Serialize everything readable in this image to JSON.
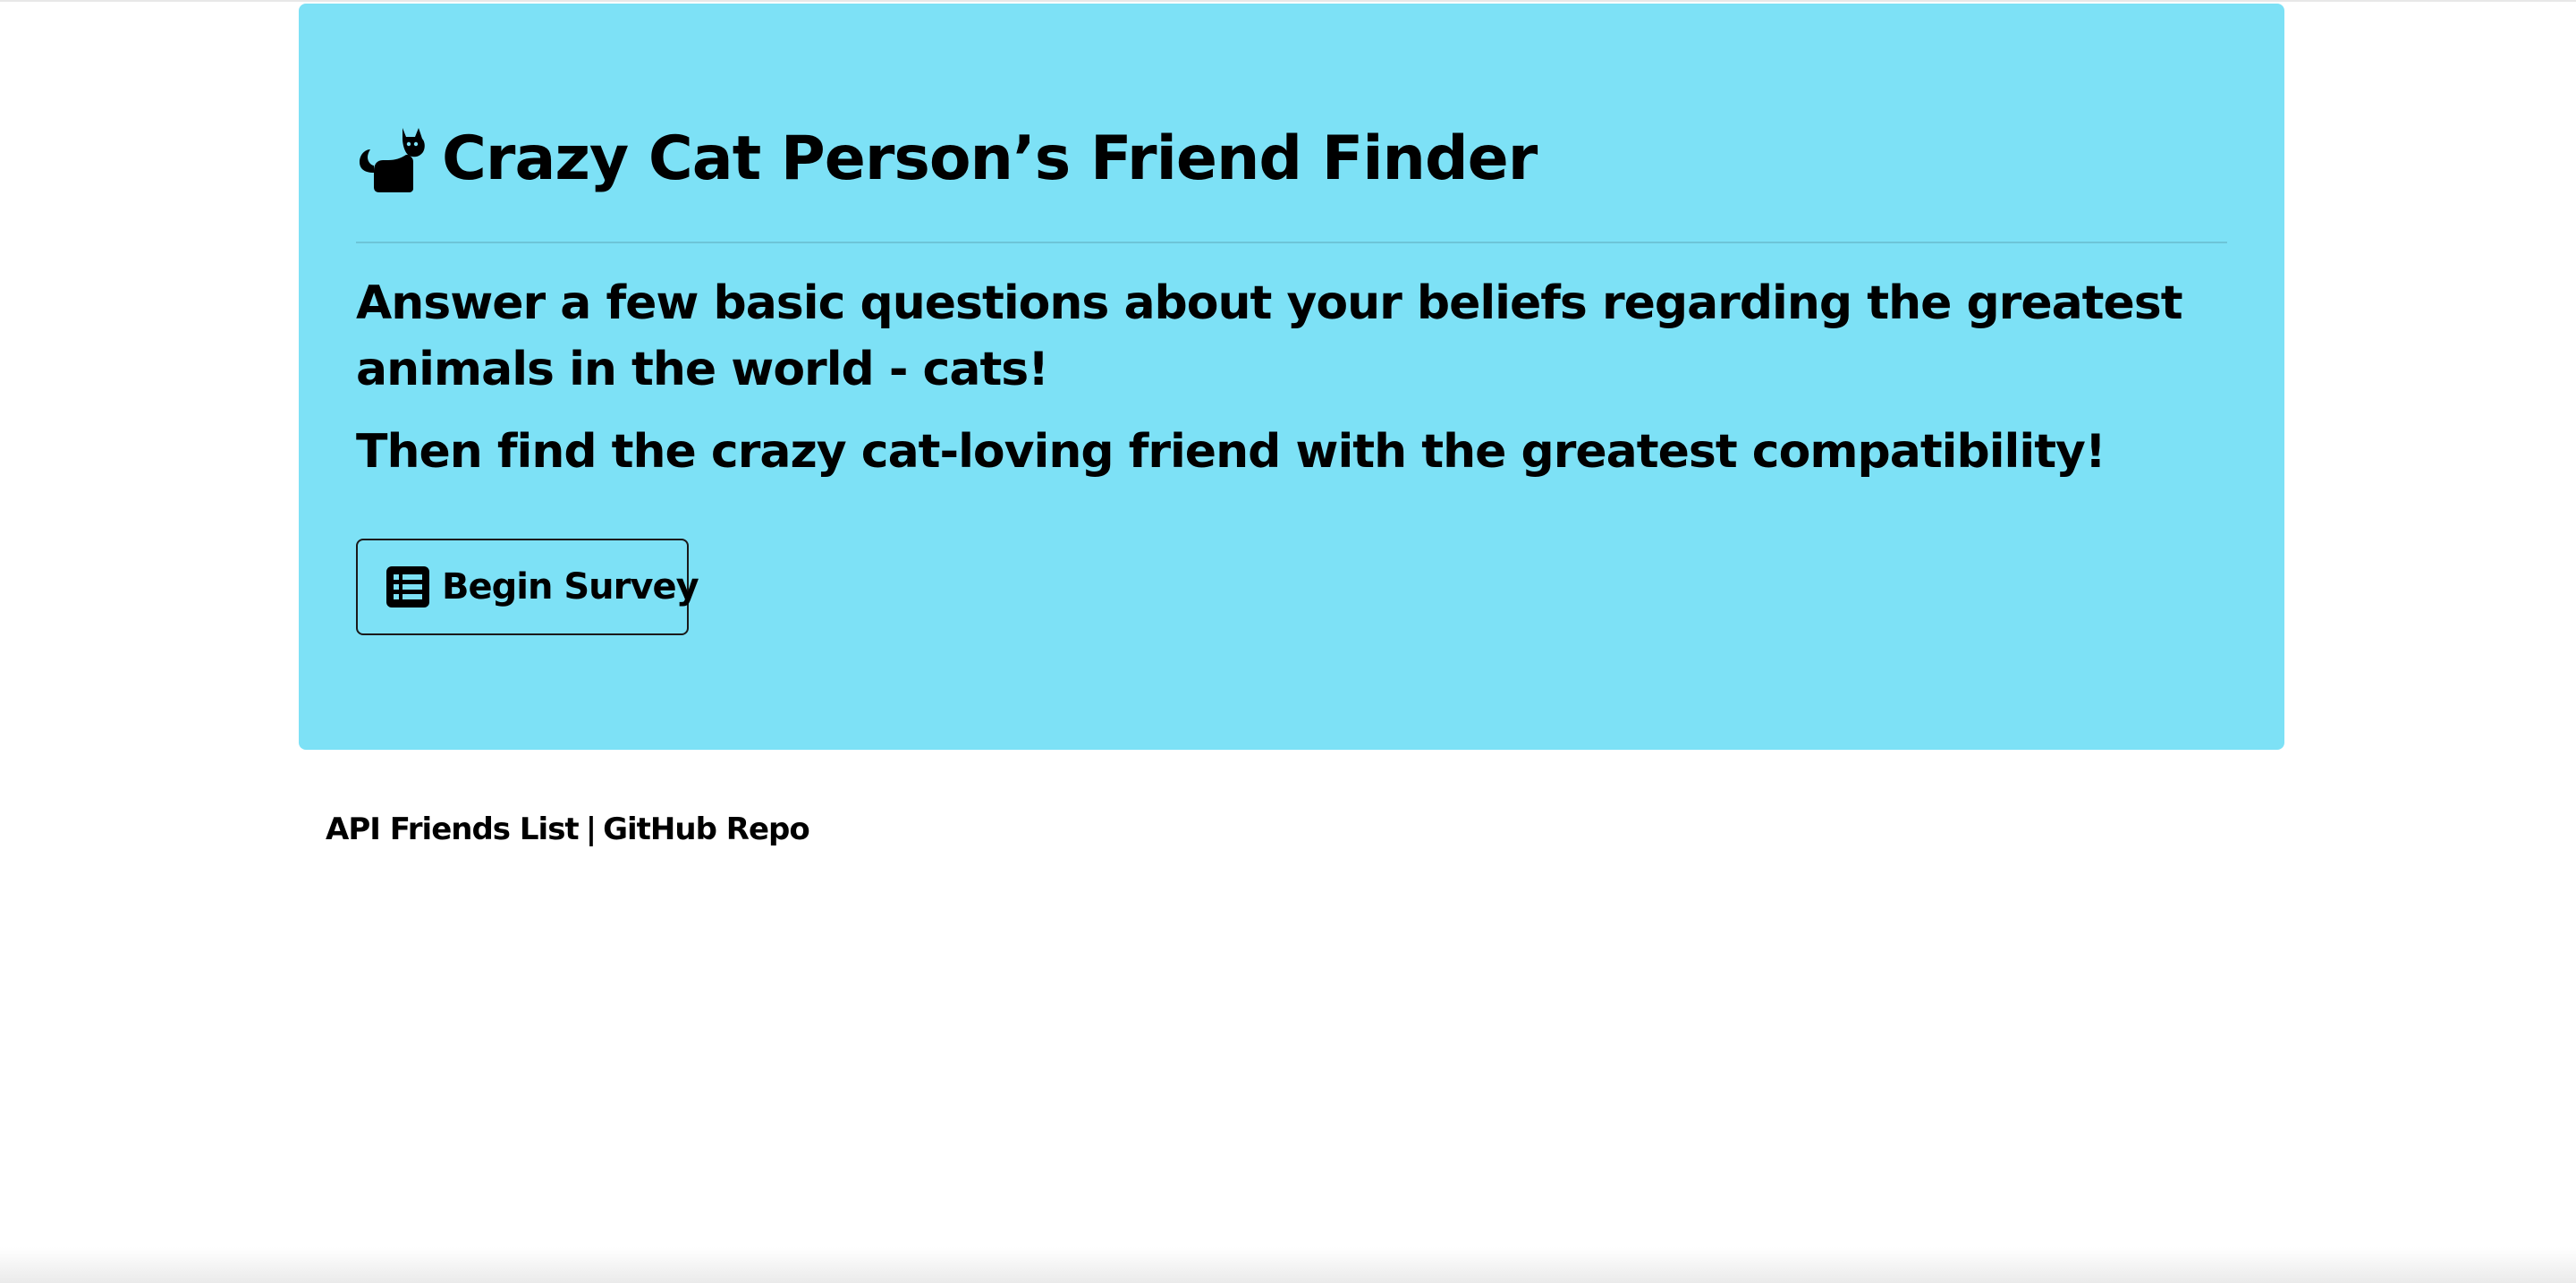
{
  "header": {
    "title": "Crazy Cat Person’s Friend Finder",
    "icon": "cat-icon"
  },
  "intro": {
    "line1": "Answer a few basic questions about your beliefs regarding the greatest animals in the world - cats!",
    "line2": "Then find the crazy cat-loving friend with the greatest compatibility!"
  },
  "actions": {
    "begin_survey_label": "Begin Survey",
    "begin_survey_icon": "list-icon"
  },
  "footer": {
    "api_link": "API Friends List",
    "separator": "|",
    "github_link": "GitHub Repo"
  },
  "colors": {
    "jumbotron_bg": "#7de1f6",
    "text": "#000000",
    "page_bg": "#ffffff"
  }
}
